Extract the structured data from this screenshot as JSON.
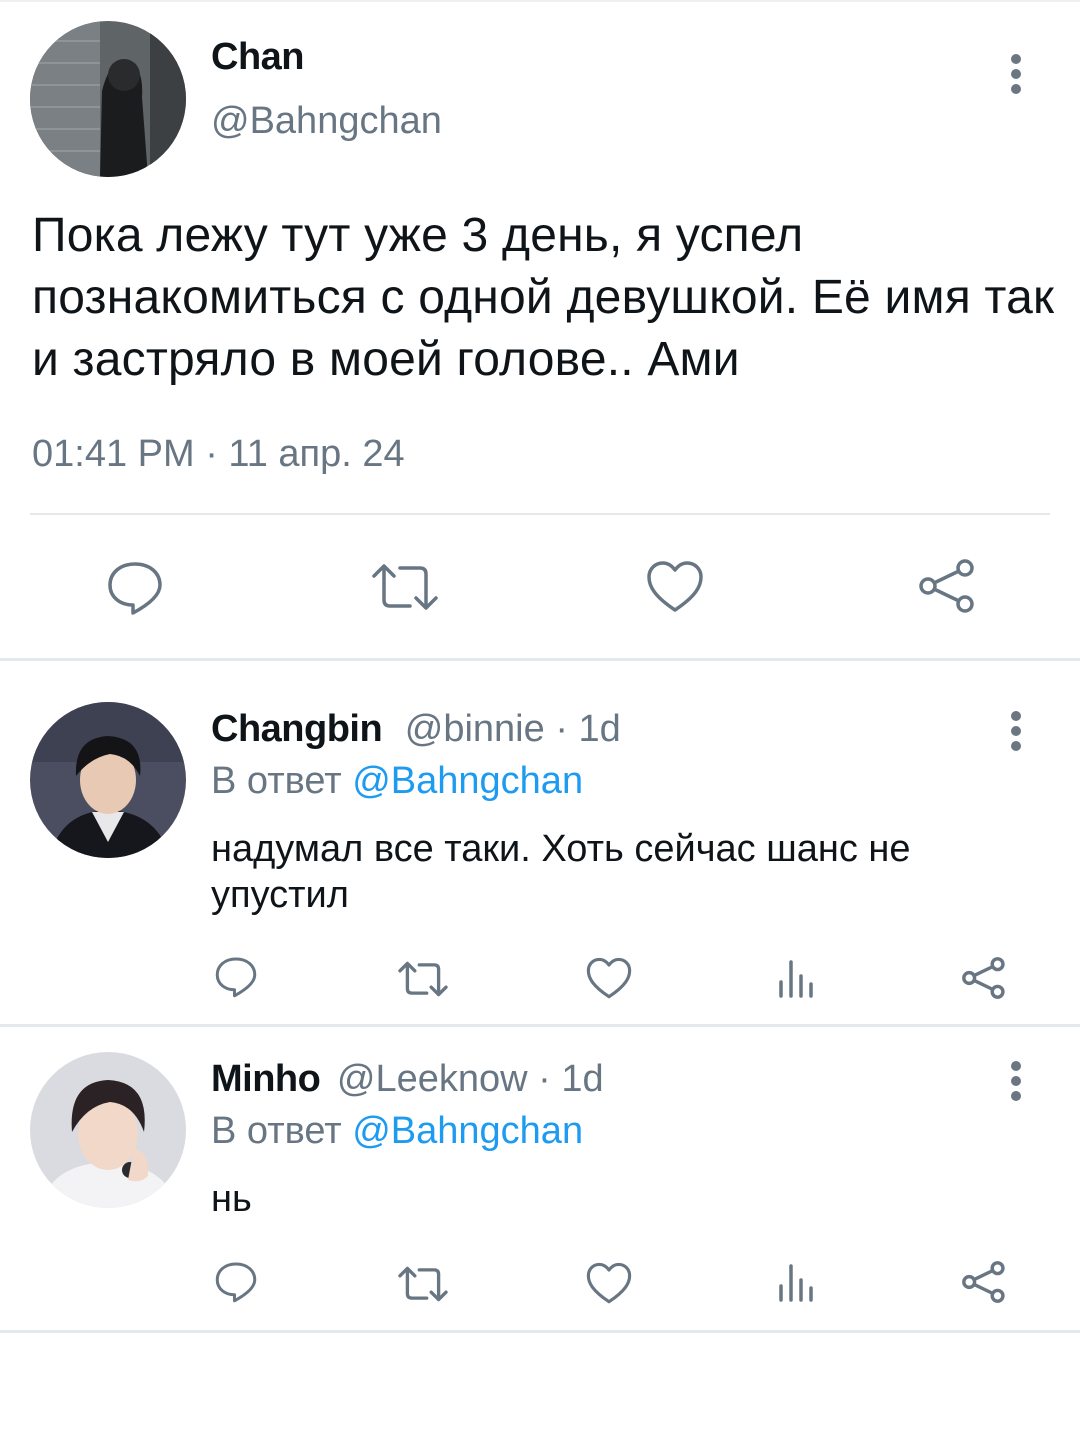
{
  "main_tweet": {
    "author_name": "Chan",
    "author_handle": "@Bahngchan",
    "text": "Пока лежу тут уже 3 день, я успел познакомиться с одной девушкой. Её имя так и застряло в моей голове.. Ами",
    "timestamp": "01:41 PM · 11 апр. 24",
    "actions": [
      "reply-icon",
      "retweet-icon",
      "like-icon",
      "share-icon"
    ]
  },
  "replies": [
    {
      "author_name": "Changbin",
      "author_handle": "@binnie",
      "time": "· 1d",
      "reply_prefix": "В ответ",
      "reply_to": "@Bahngchan",
      "text": "надумал все таки. Хоть сейчас шанс не упустил"
    },
    {
      "author_name": "Minho",
      "author_handle": "@Leeknow",
      "time": "· 1d",
      "reply_prefix": "В ответ",
      "reply_to": "@Bahngchan",
      "text": "нь"
    }
  ],
  "reply_actions": [
    "reply-icon",
    "retweet-icon",
    "like-icon",
    "stats-icon",
    "share-icon"
  ],
  "colors": {
    "text": "#0f1419",
    "secondary": "#687684",
    "mention": "#1d9bf0",
    "divider": "#e6e9eb"
  }
}
